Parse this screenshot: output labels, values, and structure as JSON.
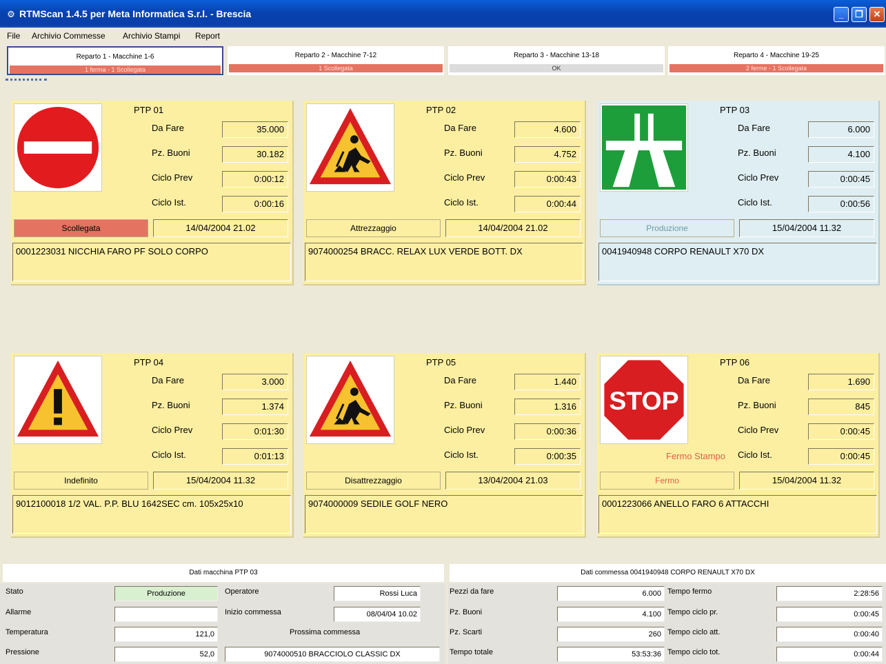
{
  "window": {
    "title": "RTMScan 1.4.5 per Meta Informatica S.r.l. - Brescia",
    "controls": {
      "minimize": "_",
      "maximize": "❐",
      "close": "✕"
    }
  },
  "menu": [
    "File",
    "Archivio Commesse",
    "Archivio Stampi",
    "Report"
  ],
  "departments": [
    {
      "name": "Reparto 1 - Macchine 1-6",
      "status": "1 ferma - 1 Scollegata",
      "selected": true
    },
    {
      "name": "Reparto 2 - Macchine 7-12",
      "status": "1 Scollegata"
    },
    {
      "name": "Reparto 3 - Macchine 13-18",
      "status": "OK"
    },
    {
      "name": "Reparto 4 - Macchine 19-25",
      "status": "2 ferme - 1 Scollegata"
    }
  ],
  "labels": {
    "da_fare": "Da Fare",
    "pz_buoni": "Pz. Buoni",
    "ciclo_prev": "Ciclo Prev",
    "ciclo_ist": "Ciclo Ist."
  },
  "machines": [
    {
      "name": "PTP 01",
      "sign": "no-entry-sign",
      "da_fare": "35.000",
      "pz_buoni": "30.182",
      "ciclo_prev": "0:00:12",
      "ciclo_ist": "0:00:16",
      "state": "Scollegata",
      "state_color": "#e57361",
      "date": "14/04/2004 21.02",
      "commessa": "0001223031 NICCHIA FARO PF SOLO CORPO"
    },
    {
      "name": "PTP 02",
      "sign": "roadwork-sign",
      "da_fare": "4.600",
      "pz_buoni": "4.752",
      "ciclo_prev": "0:00:43",
      "ciclo_ist": "0:00:44",
      "state": "Attrezzaggio",
      "date": "14/04/2004 21.02",
      "commessa": "9074000254 BRACC. RELAX LUX VERDE BOTT. DX"
    },
    {
      "name": "PTP 03",
      "sign": "motorway-sign",
      "da_fare": "6.000",
      "pz_buoni": "4.100",
      "ciclo_prev": "0:00:45",
      "ciclo_ist": "0:00:56",
      "state": "Produzione",
      "date": "15/04/2004 11.32",
      "commessa": "0041940948 CORPO RENAULT X70 DX"
    },
    {
      "name": "PTP 04",
      "sign": "warning-sign",
      "da_fare": "3.000",
      "pz_buoni": "1.374",
      "ciclo_prev": "0:01:30",
      "ciclo_ist": "0:01:13",
      "state": "Indefinito",
      "date": "15/04/2004 11.32",
      "commessa": "9012100018 1/2 VAL. P.P. BLU 1642SEC cm. 105x25x10"
    },
    {
      "name": "PTP 05",
      "sign": "roadwork-sign",
      "da_fare": "1.440",
      "pz_buoni": "1.316",
      "ciclo_prev": "0:00:36",
      "ciclo_ist": "0:00:35",
      "state": "Disattrezzaggio",
      "date": "13/04/2004 21.03",
      "commessa": "9074000009 SEDILE GOLF NERO"
    },
    {
      "name": "PTP 06",
      "sign": "stop-sign",
      "sign_text": "STOP",
      "da_fare": "1.690",
      "pz_buoni": "845",
      "ciclo_prev": "0:00:45",
      "ciclo_ist": "0:00:45",
      "state": "Fermo",
      "state_text_color": "#e25e4a",
      "extra_label": "Fermo Stampo",
      "date": "15/04/2004 11.32",
      "commessa": "0001223066 ANELLO FARO 6 ATTACCHI"
    }
  ],
  "machine_details": {
    "header": "Dati macchina PTP 03",
    "stato_label": "Stato",
    "stato": "Produzione",
    "allarme_label": "Allarme",
    "allarme": "",
    "temperatura_label": "Temperatura",
    "temperatura": "121,0",
    "pressione_label": "Pressione",
    "pressione": "52,0",
    "operatore_label": "Operatore",
    "operatore": "Rossi Luca",
    "inizio_label": "Inizio commessa",
    "inizio": "08/04/04 10.02",
    "prossima_label": "Prossima commessa",
    "prossima": "9074000510 BRACCIOLO CLASSIC DX"
  },
  "order_details": {
    "header": "Dati commessa 0041940948 CORPO RENAULT X70 DX",
    "pezzi_label": "Pezzi da fare",
    "pezzi": "6.000",
    "buoni_label": "Pz. Buoni",
    "buoni": "4.100",
    "scarti_label": "Pz. Scarti",
    "scarti": "260",
    "totale_label": "Tempo totale",
    "totale": "53:53:36",
    "fermo_label": "Tempo fermo",
    "fermo": "2:28:56",
    "ciclo_pr_label": "Tempo ciclo pr.",
    "ciclo_pr": "0:00:45",
    "ciclo_att_label": "Tempo ciclo att.",
    "ciclo_att": "0:00:40",
    "ciclo_tot_label": "Tempo ciclo tot.",
    "ciclo_tot": "0:00:44"
  }
}
